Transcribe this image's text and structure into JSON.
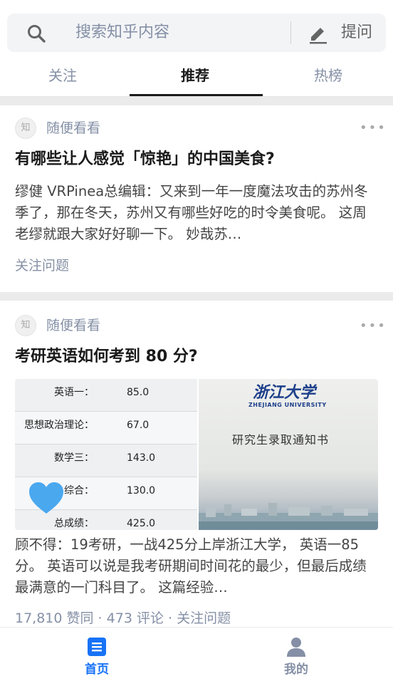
{
  "search": {
    "placeholder": "搜索知乎内容",
    "ask_label": "提问"
  },
  "tabs": [
    {
      "label": "关注",
      "active": false
    },
    {
      "label": "推荐",
      "active": true
    },
    {
      "label": "热榜",
      "active": false
    }
  ],
  "feed": [
    {
      "avatar_text": "知",
      "source": "随便看看",
      "title": "有哪些让人感觉「惊艳」的中国美食?",
      "excerpt": "缪健 VRPinea总编辑：又来到一年一度魔法攻击的苏州冬季了，那在冬天，苏州又有哪些好吃的时令美食呢。 这周老缪就跟大家好好聊一下。 妙哉苏…",
      "action": "关注问题"
    },
    {
      "avatar_text": "知",
      "source": "随便看看",
      "title": "考研英语如何考到 80 分?",
      "image": {
        "scores": [
          {
            "subject": "英语一：",
            "score": "85.0"
          },
          {
            "subject": "思想政治理论：",
            "score": "67.0"
          },
          {
            "subject": "数学三：",
            "score": "143.0"
          },
          {
            "subject": "综合：",
            "score": "130.0"
          },
          {
            "subject": "总成绩：",
            "score": "425.0"
          }
        ],
        "university_cn": "浙江大学",
        "university_en": "ZHEJIANG UNIVERSITY",
        "notice": "研究生录取通知书"
      },
      "excerpt": "顾不得：19考研，一战425分上岸浙江大学， 英语一85分。 英语可以说是我考研期间时间花的最少，但最后成绩最满意的一门科目了。 这篇经验…",
      "stats": "17,810 赞同 · 473 评论 · 关注问题"
    }
  ],
  "bottom_nav": [
    {
      "label": "首页",
      "icon": "home-feed-icon",
      "active": true
    },
    {
      "label": "我的",
      "icon": "person-icon",
      "active": false
    }
  ],
  "colors": {
    "accent": "#1772f6",
    "muted": "#8590a6",
    "heart": "#4aa8ef"
  }
}
